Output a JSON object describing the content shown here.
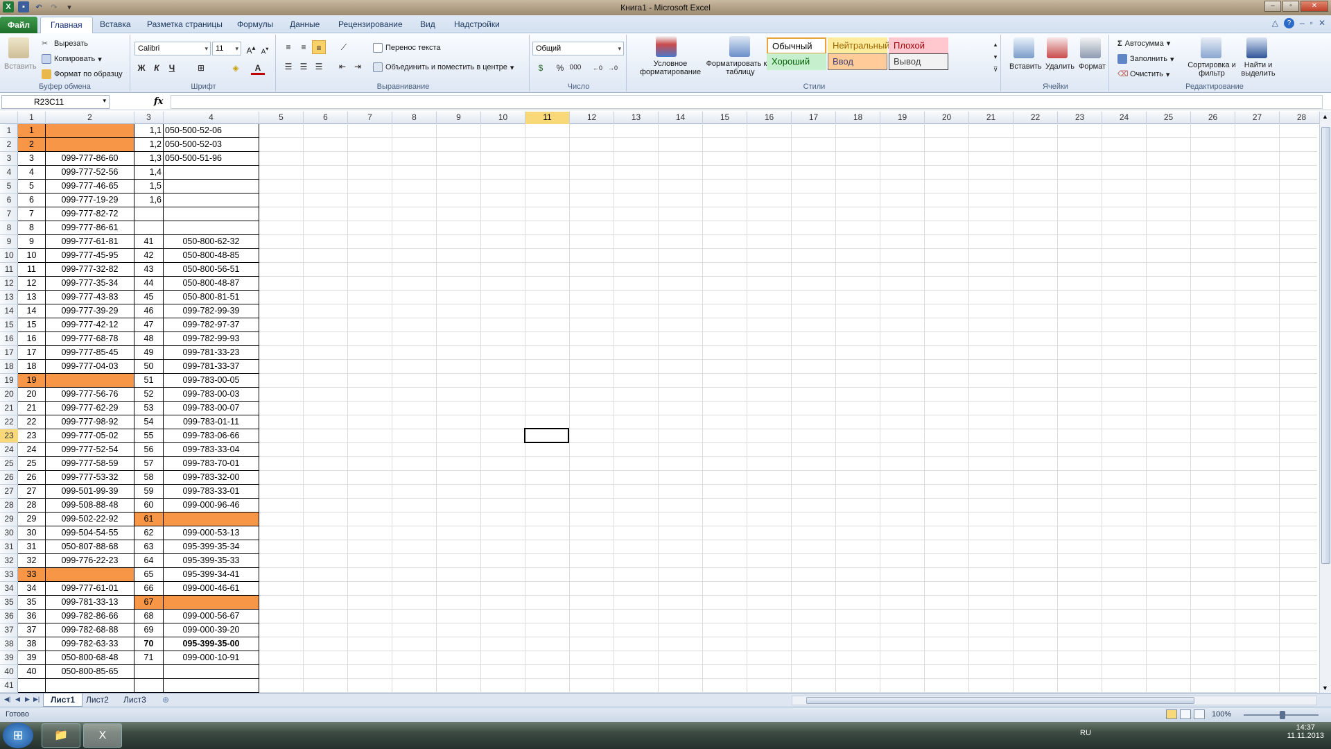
{
  "window": {
    "title": "Книга1 - Microsoft Excel",
    "controls": [
      "–",
      "▫",
      "✕"
    ]
  },
  "tabs": {
    "file": "Файл",
    "items": [
      "Главная",
      "Вставка",
      "Разметка страницы",
      "Формулы",
      "Данные",
      "Рецензирование",
      "Вид",
      "Надстройки"
    ],
    "active_index": 0
  },
  "ribbon": {
    "clipboard": {
      "label": "Буфер обмена",
      "paste": "Вставить",
      "cut": "Вырезать",
      "copy": "Копировать",
      "format_painter": "Формат по образцу"
    },
    "font": {
      "label": "Шрифт",
      "name": "Calibri",
      "size": "11",
      "bold": "Ж",
      "italic": "К",
      "underline": "Ч"
    },
    "alignment": {
      "label": "Выравнивание",
      "wrap": "Перенос текста",
      "merge": "Объединить и поместить в центре"
    },
    "number": {
      "label": "Число",
      "format": "Общий",
      "percent": "%",
      "thousands": "000"
    },
    "styles": {
      "label": "Стили",
      "conditional": "Условное форматирование",
      "as_table": "Форматировать как таблицу",
      "cells": [
        {
          "text": "Обычный",
          "bg": "#ffffff",
          "fg": "#000000",
          "border": "#e8a33a"
        },
        {
          "text": "Нейтральный",
          "bg": "#ffeb9c",
          "fg": "#9c6500",
          "border": "#ffeb9c"
        },
        {
          "text": "Плохой",
          "bg": "#ffc7ce",
          "fg": "#9c0006",
          "border": "#ffc7ce"
        },
        {
          "text": "Хороший",
          "bg": "#c6efce",
          "fg": "#006100",
          "border": "#c6efce"
        },
        {
          "text": "Ввод",
          "bg": "#ffcc99",
          "fg": "#3f3f76",
          "border": "#7f7f7f"
        },
        {
          "text": "Вывод",
          "bg": "#f2f2f2",
          "fg": "#3f3f3f",
          "border": "#3f3f3f"
        }
      ]
    },
    "cells": {
      "label": "Ячейки",
      "insert": "Вставить",
      "delete": "Удалить",
      "format": "Формат"
    },
    "editing": {
      "label": "Редактирование",
      "autosum": "Автосумма",
      "fill": "Заполнить",
      "clear": "Очистить",
      "sort": "Сортировка и фильтр",
      "find": "Найти и выделить"
    }
  },
  "formula_bar": {
    "name_box": "R23C11",
    "fx": "fx",
    "content": ""
  },
  "columns": [
    "1",
    "2",
    "3",
    "4",
    "5",
    "6",
    "7",
    "8",
    "9",
    "10",
    "11",
    "12",
    "13",
    "14",
    "15",
    "16",
    "17",
    "18",
    "19",
    "20",
    "21",
    "22",
    "23",
    "24",
    "25",
    "26",
    "27",
    "28"
  ],
  "selected_column": "11",
  "selected_row": "23",
  "rows": [
    {
      "n": "1",
      "a": "1",
      "b": "",
      "c": "1,1",
      "d": "050-500-52-06",
      "a_or": true,
      "b_or": true
    },
    {
      "n": "2",
      "a": "2",
      "b": "",
      "c": "1,2",
      "d": "050-500-52-03",
      "a_or": true,
      "b_or": true
    },
    {
      "n": "3",
      "a": "3",
      "b": "099-777-86-60",
      "c": "1,3",
      "d": "050-500-51-96"
    },
    {
      "n": "4",
      "a": "4",
      "b": "099-777-52-56",
      "c": "1,4",
      "d": ""
    },
    {
      "n": "5",
      "a": "5",
      "b": "099-777-46-65",
      "c": "1,5",
      "d": ""
    },
    {
      "n": "6",
      "a": "6",
      "b": "099-777-19-29",
      "c": "1,6",
      "d": ""
    },
    {
      "n": "7",
      "a": "7",
      "b": "099-777-82-72",
      "c": "",
      "d": ""
    },
    {
      "n": "8",
      "a": "8",
      "b": "099-777-86-61",
      "c": "",
      "d": ""
    },
    {
      "n": "9",
      "a": "9",
      "b": "099-777-61-81",
      "c": "41",
      "d": "050-800-62-32"
    },
    {
      "n": "10",
      "a": "10",
      "b": "099-777-45-95",
      "c": "42",
      "d": "050-800-48-85"
    },
    {
      "n": "11",
      "a": "11",
      "b": "099-777-32-82",
      "c": "43",
      "d": "050-800-56-51"
    },
    {
      "n": "12",
      "a": "12",
      "b": "099-777-35-34",
      "c": "44",
      "d": "050-800-48-87"
    },
    {
      "n": "13",
      "a": "13",
      "b": "099-777-43-83",
      "c": "45",
      "d": "050-800-81-51"
    },
    {
      "n": "14",
      "a": "14",
      "b": "099-777-39-29",
      "c": "46",
      "d": "099-782-99-39"
    },
    {
      "n": "15",
      "a": "15",
      "b": "099-777-42-12",
      "c": "47",
      "d": "099-782-97-37"
    },
    {
      "n": "16",
      "a": "16",
      "b": "099-777-68-78",
      "c": "48",
      "d": "099-782-99-93"
    },
    {
      "n": "17",
      "a": "17",
      "b": "099-777-85-45",
      "c": "49",
      "d": "099-781-33-23"
    },
    {
      "n": "18",
      "a": "18",
      "b": "099-777-04-03",
      "c": "50",
      "d": "099-781-33-37"
    },
    {
      "n": "19",
      "a": "19",
      "b": "",
      "c": "51",
      "d": "099-783-00-05",
      "a_or": true,
      "b_or": true
    },
    {
      "n": "20",
      "a": "20",
      "b": "099-777-56-76",
      "c": "52",
      "d": "099-783-00-03"
    },
    {
      "n": "21",
      "a": "21",
      "b": "099-777-62-29",
      "c": "53",
      "d": "099-783-00-07"
    },
    {
      "n": "22",
      "a": "22",
      "b": "099-777-98-92",
      "c": "54",
      "d": "099-783-01-11"
    },
    {
      "n": "23",
      "a": "23",
      "b": "099-777-05-02",
      "c": "55",
      "d": "099-783-06-66"
    },
    {
      "n": "24",
      "a": "24",
      "b": "099-777-52-54",
      "c": "56",
      "d": "099-783-33-04"
    },
    {
      "n": "25",
      "a": "25",
      "b": "099-777-58-59",
      "c": "57",
      "d": "099-783-70-01"
    },
    {
      "n": "26",
      "a": "26",
      "b": "099-777-53-32",
      "c": "58",
      "d": "099-783-32-00"
    },
    {
      "n": "27",
      "a": "27",
      "b": "099-501-99-39",
      "c": "59",
      "d": "099-783-33-01"
    },
    {
      "n": "28",
      "a": "28",
      "b": "099-508-88-48",
      "c": "60",
      "d": "099-000-96-46"
    },
    {
      "n": "29",
      "a": "29",
      "b": "099-502-22-92",
      "c": "61",
      "d": "",
      "c_or": true,
      "d_or": true
    },
    {
      "n": "30",
      "a": "30",
      "b": "099-504-54-55",
      "c": "62",
      "d": "099-000-53-13"
    },
    {
      "n": "31",
      "a": "31",
      "b": "050-807-88-68",
      "c": "63",
      "d": "095-399-35-34"
    },
    {
      "n": "32",
      "a": "32",
      "b": "099-776-22-23",
      "c": "64",
      "d": "095-399-35-33"
    },
    {
      "n": "33",
      "a": "33",
      "b": "",
      "c": "65",
      "d": "095-399-34-41",
      "a_or": true,
      "b_or": true
    },
    {
      "n": "34",
      "a": "34",
      "b": "099-777-61-01",
      "c": "66",
      "d": "099-000-46-61"
    },
    {
      "n": "35",
      "a": "35",
      "b": "099-781-33-13",
      "c": "67",
      "d": "",
      "c_or": true,
      "d_or": true
    },
    {
      "n": "36",
      "a": "36",
      "b": "099-782-86-66",
      "c": "68",
      "d": "099-000-56-67"
    },
    {
      "n": "37",
      "a": "37",
      "b": "099-782-68-88",
      "c": "69",
      "d": "099-000-39-20"
    },
    {
      "n": "38",
      "a": "38",
      "b": "099-782-63-33",
      "c": "70",
      "d": "095-399-35-00",
      "c_bold": true,
      "d_bold": true
    },
    {
      "n": "39",
      "a": "39",
      "b": "050-800-68-48",
      "c": "71",
      "d": "099-000-10-91"
    },
    {
      "n": "40",
      "a": "40",
      "b": "050-800-85-65",
      "c": "",
      "d": ""
    },
    {
      "n": "41",
      "a": "",
      "b": "",
      "c": "",
      "d": ""
    }
  ],
  "sheets": [
    "Лист1",
    "Лист2",
    "Лист3"
  ],
  "active_sheet": 0,
  "status": {
    "ready": "Готово",
    "zoom": "100%"
  },
  "taskbar": {
    "lang": "RU",
    "time": "14:37",
    "date": "11.11.2013"
  }
}
